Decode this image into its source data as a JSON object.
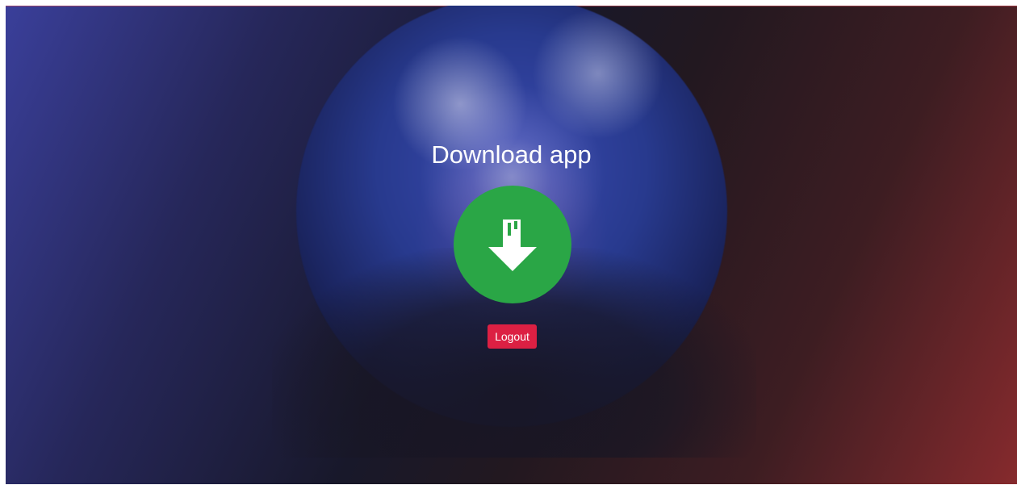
{
  "page": {
    "title": "Download app"
  },
  "download_button": {
    "icon": "download-arrow-icon",
    "color": "#2aa646"
  },
  "logout_button": {
    "label": "Logout",
    "color": "#dc2043"
  },
  "background": {
    "image": "earth-globe",
    "gradient_start": "#3a3f9a",
    "gradient_end": "#862a2d"
  }
}
